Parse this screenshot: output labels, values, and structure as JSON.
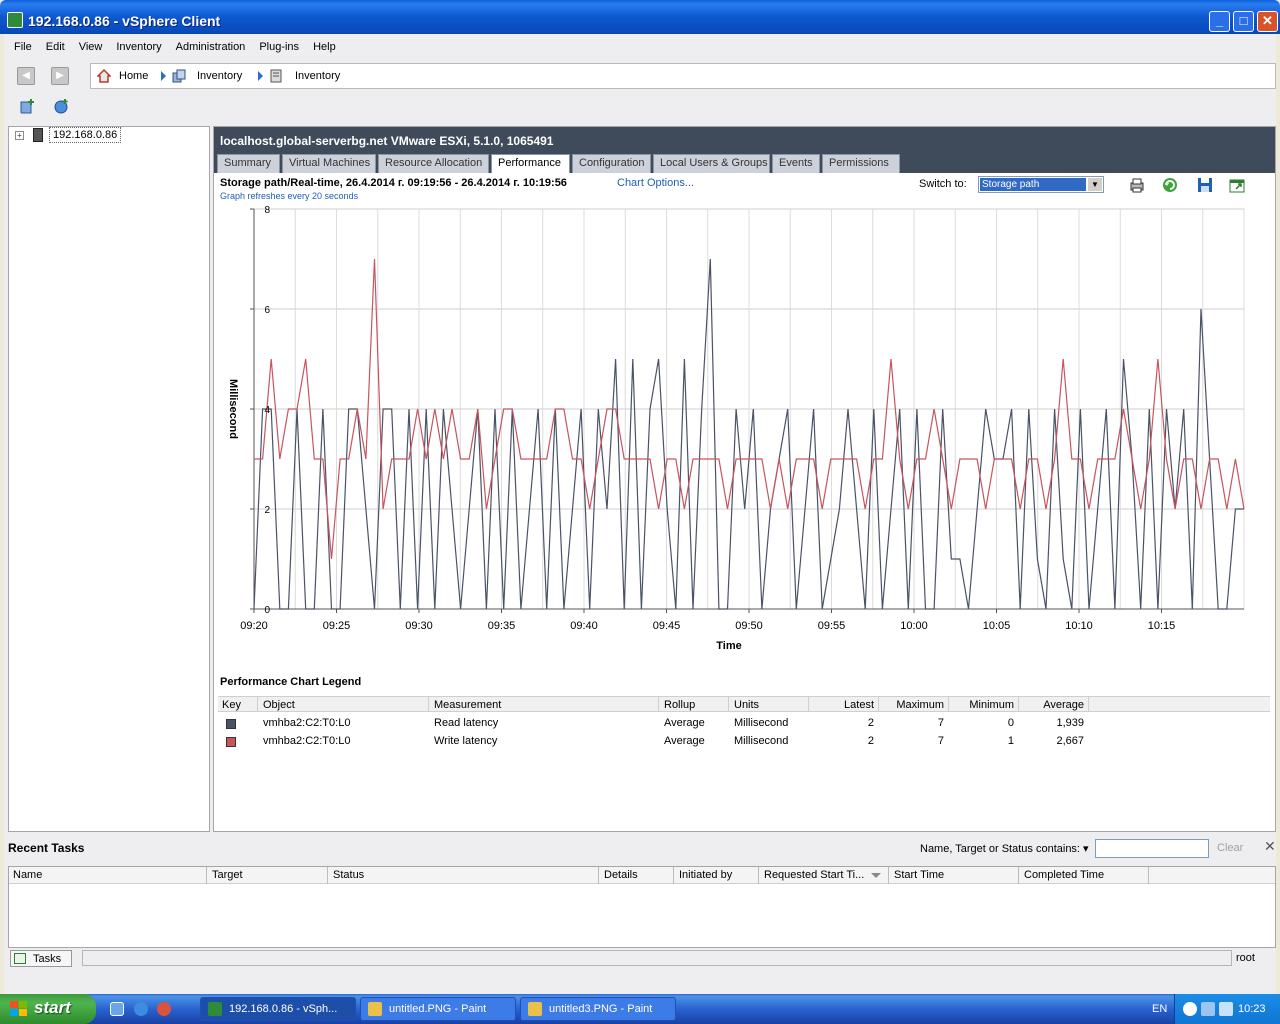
{
  "window": {
    "title": "192.168.0.86 - vSphere Client",
    "minimize": "_",
    "maximize": "□",
    "close": "✕"
  },
  "menu": [
    "File",
    "Edit",
    "View",
    "Inventory",
    "Administration",
    "Plug-ins",
    "Help"
  ],
  "nav": {
    "back": "◀",
    "forward": "▶",
    "crumbs": [
      "Home",
      "Inventory",
      "Inventory"
    ]
  },
  "tree": {
    "expander": "+",
    "host": "192.168.0.86"
  },
  "host": {
    "title": "localhost.global-serverbg.net VMware ESXi, 5.1.0, 1065491",
    "tabs": [
      "Summary",
      "Virtual Machines",
      "Resource Allocation",
      "Performance",
      "Configuration",
      "Local Users & Groups",
      "Events",
      "Permissions"
    ],
    "active_tab": "Performance"
  },
  "perf": {
    "header": "Storage path/Real-time, 26.4.2014 г. 09:19:56 - 26.4.2014 г. 10:19:56",
    "chart_options": "Chart Options...",
    "refresh_note": "Graph refreshes every 20 seconds",
    "switch_label": "Switch to:",
    "switch_value": "Storage path",
    "switch_arrow": "▼"
  },
  "chart_data": {
    "type": "line",
    "ylabel": "Millisecond",
    "xlabel": "Time",
    "ylim": [
      0,
      8
    ],
    "yticks": [
      "0",
      "2",
      "4",
      "6",
      "8"
    ],
    "xticks": [
      "09:20",
      "09:25",
      "09:30",
      "09:35",
      "09:40",
      "09:45",
      "09:50",
      "09:55",
      "10:00",
      "10:05",
      "10:10",
      "10:15"
    ],
    "grid": true,
    "colors": {
      "read": "#4a5266",
      "write": "#c8545f"
    },
    "series": [
      {
        "name": "Read latency",
        "values": [
          0,
          4,
          4,
          0,
          0,
          4,
          0,
          0,
          4,
          0,
          0,
          4,
          4,
          2,
          0,
          4,
          4,
          0,
          4,
          0,
          4,
          0,
          4,
          2,
          0,
          2,
          4,
          0,
          4,
          0,
          4,
          0,
          2,
          4,
          0,
          4,
          0,
          2,
          4,
          0,
          4,
          2,
          5,
          0,
          5,
          0,
          4,
          5,
          2,
          0,
          5,
          0,
          4,
          7,
          0,
          0,
          4,
          2,
          4,
          0,
          2,
          3,
          4,
          0,
          2,
          4,
          0,
          1,
          2,
          4,
          2,
          0,
          4,
          0,
          2,
          4,
          0,
          4,
          0,
          0,
          4,
          1,
          1,
          0,
          2,
          4,
          3,
          3,
          4,
          0,
          4,
          1,
          0,
          4,
          1,
          0,
          4,
          0,
          2,
          4,
          0,
          5,
          3,
          0,
          4,
          0,
          4,
          2,
          4,
          0,
          6,
          3,
          0,
          0,
          2,
          2
        ]
      },
      {
        "name": "Write latency",
        "values": [
          3,
          3,
          5,
          3,
          4,
          4,
          5,
          3,
          3,
          1,
          3,
          3,
          4,
          3,
          7,
          2,
          3,
          3,
          3,
          4,
          3,
          4,
          3,
          4,
          3,
          3,
          4,
          2,
          3,
          4,
          4,
          3,
          3,
          3,
          3,
          4,
          4,
          3,
          3,
          2,
          3,
          4,
          4,
          3,
          3,
          3,
          3,
          2,
          3,
          3,
          2,
          3,
          3,
          3,
          3,
          2,
          3,
          3,
          3,
          3,
          2,
          3,
          2,
          3,
          3,
          3,
          2,
          3,
          3,
          3,
          3,
          2,
          3,
          3,
          5,
          3,
          2,
          3,
          3,
          4,
          3,
          2,
          3,
          3,
          3,
          2,
          3,
          3,
          3,
          2,
          3,
          3,
          2,
          3,
          5,
          3,
          3,
          2,
          3,
          3,
          3,
          4,
          3,
          2,
          3,
          5,
          3,
          2,
          3,
          3,
          2,
          3,
          3,
          2,
          3,
          2
        ]
      }
    ]
  },
  "legend": {
    "title": "Performance Chart Legend",
    "headers": {
      "key": "Key",
      "object": "Object",
      "measurement": "Measurement",
      "rollup": "Rollup",
      "units": "Units",
      "latest": "Latest",
      "maximum": "Maximum",
      "minimum": "Minimum",
      "average": "Average"
    },
    "rows": [
      {
        "object": "vmhba2:C2:T0:L0",
        "measurement": "Read latency",
        "rollup": "Average",
        "units": "Millisecond",
        "latest": "2",
        "maximum": "7",
        "minimum": "0",
        "average": "1,939"
      },
      {
        "object": "vmhba2:C2:T0:L0",
        "measurement": "Write latency",
        "rollup": "Average",
        "units": "Millisecond",
        "latest": "2",
        "maximum": "7",
        "minimum": "1",
        "average": "2,667"
      }
    ]
  },
  "recent_tasks": {
    "title": "Recent Tasks",
    "filter_label": "Name, Target or Status contains: ▾",
    "filter_value": "",
    "clear": "Clear",
    "close": "✕",
    "columns": [
      "Name",
      "Target",
      "Status",
      "Details",
      "Initiated by",
      "Requested Start Ti...",
      "Start Time",
      "Completed Time"
    ]
  },
  "statusbar": {
    "tasks_tab": "Tasks",
    "user": "root"
  },
  "taskbar": {
    "start": "start",
    "buttons": [
      "192.168.0.86 - vSph...",
      "untitled.PNG - Paint",
      "untitled3.PNG - Paint"
    ],
    "lang": "EN",
    "clock": "10:23"
  }
}
